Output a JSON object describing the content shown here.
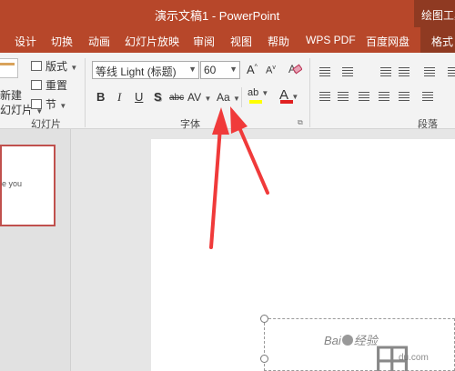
{
  "window": {
    "title": "演示文稿1 - PowerPoint",
    "tools_label": "绘图工具"
  },
  "tabs": [
    {
      "label": "设计"
    },
    {
      "label": "切换"
    },
    {
      "label": "动画"
    },
    {
      "label": "幻灯片放映"
    },
    {
      "label": "审阅"
    },
    {
      "label": "视图"
    },
    {
      "label": "帮助"
    },
    {
      "label": "WPS PDF"
    },
    {
      "label": "百度网盘"
    },
    {
      "label": "格式"
    }
  ],
  "slides_group": {
    "new_slide_line1": "新建",
    "new_slide_line2": "幻灯片",
    "layout_label": "版式",
    "reset_label": "重置",
    "section_label": "节",
    "group_label": "幻灯片"
  },
  "font_group": {
    "font_name": "等线 Light (标题)",
    "font_size": "60",
    "grow": "A",
    "shrink": "A",
    "bold": "B",
    "italic": "I",
    "underline": "U",
    "shadow": "S",
    "strike": "abc",
    "spacing": "AV",
    "change_case": "Aa",
    "highlight": "ab",
    "font_color": "A",
    "group_label": "字体",
    "highlight_color": "#ffff00",
    "font_color_value": "#e02020"
  },
  "paragraph_group": {
    "group_label": "段落"
  },
  "thumbnail": {
    "text": "e you"
  },
  "watermark": {
    "brand": "Bai",
    "brand_rest": "经验",
    "sub": "du.com"
  },
  "colors": {
    "accent": "#b7472a",
    "annotation_arrow": "#f03a3a"
  }
}
